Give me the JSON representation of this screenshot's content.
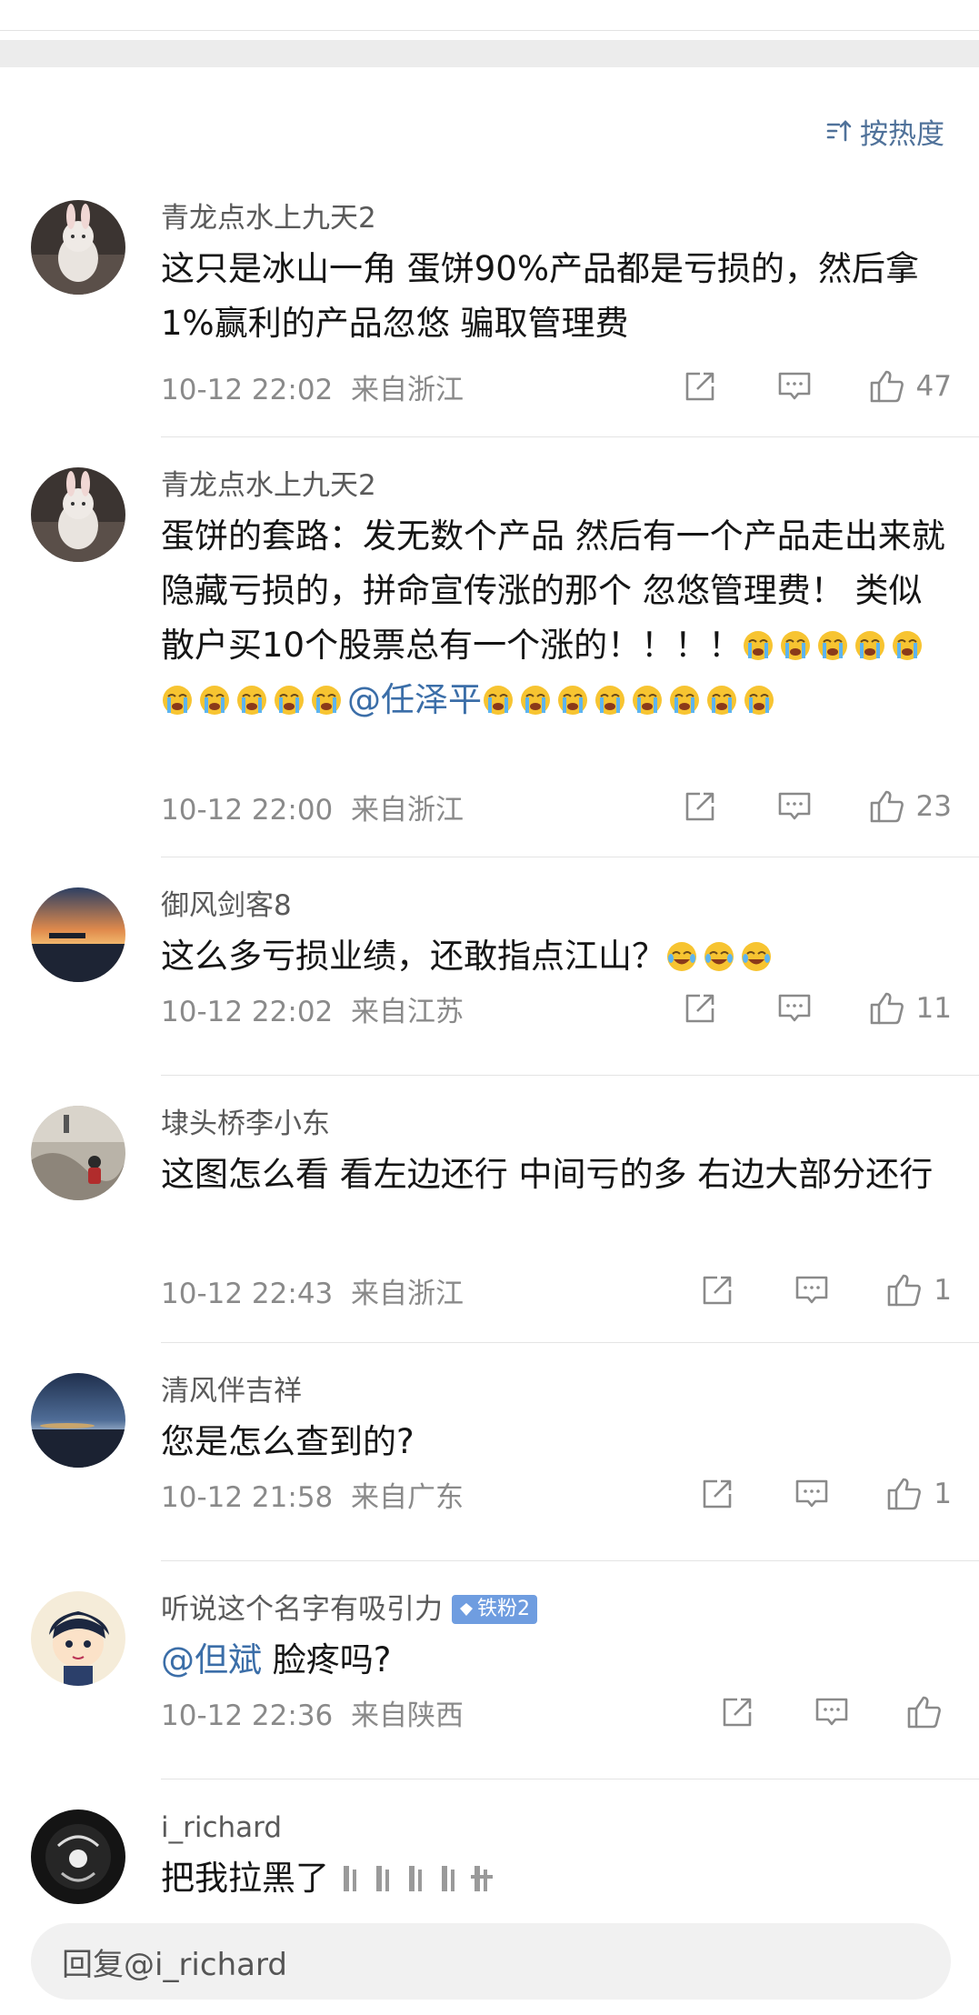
{
  "sort": {
    "label": "按热度",
    "icon": "sort-icon"
  },
  "comments": [
    {
      "username": "青龙点水上九天2",
      "text": "这只是冰山一角 蛋饼90%产品都是亏损的，然后拿1%赢利的产品忽悠 骗取管理费",
      "time": "10-12 22:02",
      "location": "来自浙江",
      "likes": "47"
    },
    {
      "username": "青龙点水上九天2",
      "text_a": "蛋饼的套路：发无数个产品 然后有一个产品走出来就隐藏亏损的，拼命宣传涨的那个 忽悠管理费！ 类似散户买10个股票总有一个涨的！！！！",
      "mention": "@任泽平",
      "time": "10-12 22:00",
      "location": "来自浙江",
      "likes": "23"
    },
    {
      "username": "御风剑客8",
      "text": "这么多亏损业绩，还敢指点江山？",
      "time": "10-12 22:02",
      "location": "来自江苏",
      "likes": "11"
    },
    {
      "username": "埭头桥李小东",
      "text": "这图怎么看  看左边还行 中间亏的多 右边大部分还行",
      "time": "10-12 22:43",
      "location": "来自浙江",
      "likes": "1"
    },
    {
      "username": "清风伴吉祥",
      "text": "您是怎么查到的?",
      "time": "10-12 21:58",
      "location": "来自广东",
      "likes": "1"
    },
    {
      "username": "听说这个名字有吸引力",
      "badge": "铁粉2",
      "mention": "@但斌",
      "text": "脸疼吗?",
      "time": "10-12 22:36",
      "location": "来自陕西"
    },
    {
      "username": "i_richard",
      "text": "把我拉黑了"
    }
  ],
  "reply_placeholder": "回复@i_richard",
  "colors": {
    "accent": "#50729a",
    "mention": "#3b6ea8",
    "badge": "#6f9de0"
  }
}
